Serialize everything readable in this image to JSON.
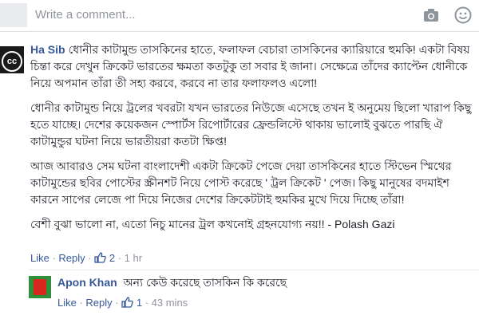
{
  "composer": {
    "placeholder": "Write a comment..."
  },
  "comment": {
    "author": "Ha Sib",
    "avatar_text": "cc",
    "paragraphs": [
      "ধোনীর কাটামুন্ড তাসকিনের হাতে, ফলাফল বেচারা তাসকিনের ক্যারিয়ারে হুমকি! একটা বিষয় চিন্তা করে দেখুন ক্রিকেট ভারতের ক্ষমতা কতটুকু তা সবার ই জানা। সেক্ষেত্রে তাঁদের ক্যাপ্টেন ধোনীকে নিয়ে অপমান তাঁরা তী সহ্য করবে, করবে না তার ফলাফলও এলো!",
      "ধোনীর কাটামুন্ড নিয়ে ট্রলের খবরটা যখন ভারতের নিউজে এসেছে তখন ই অনুমেয় ছিলো খারাপ কিছু হতে যাচ্ছে। দেশের কয়েকজন স্পোর্টস রিপোর্টারের ফ্রেন্ডলিস্টে থাকায় ভালোই বুঝতে পারছি ঐ কাটামুন্ডুর ঘটনা নিয়ে ভারতীয়রা কতটা ক্ষিপ্ত!",
      "আজ আবারও সেম ঘটনা বাংলাদেশী একটা ক্রিকেট পেজে দেয়া তাসকিনের হাতে স্টিভেন স্মিথের কাটামুন্ডের ছবির পোস্টের স্ক্রীনশট নিয়ে পোস্ট করেছে ' ট্রল ক্রিকেট ' পেজ। কিছু মানুষের বদমাইশ কারনে সাপের লেজে পা দিয়ে নিজের দেশের ক্রিকেটটাই হুমকির মুখে দিয়ে দিচ্ছে তাঁরা!",
      "বেশী বুঝা ভালো না, এতো নিচু মানের ট্রল কখনোই গ্রহনযোগ্য নয়!! - Polash Gazi"
    ],
    "like_label": "Like",
    "reply_label": "Reply",
    "like_count": "2",
    "time": "1 hr"
  },
  "reply": {
    "author": "Apon Khan",
    "text": "অন্য কেউ করেছে তাসকিন কি করেছে",
    "like_label": "Like",
    "reply_label": "Reply",
    "like_count": "1",
    "time": "43 mins"
  },
  "colors": {
    "author": "#365899",
    "meta": "#90949c",
    "divider": "#dddfe2"
  },
  "icons": [
    "camera-icon",
    "emoji-icon",
    "thumbs-up-icon"
  ]
}
